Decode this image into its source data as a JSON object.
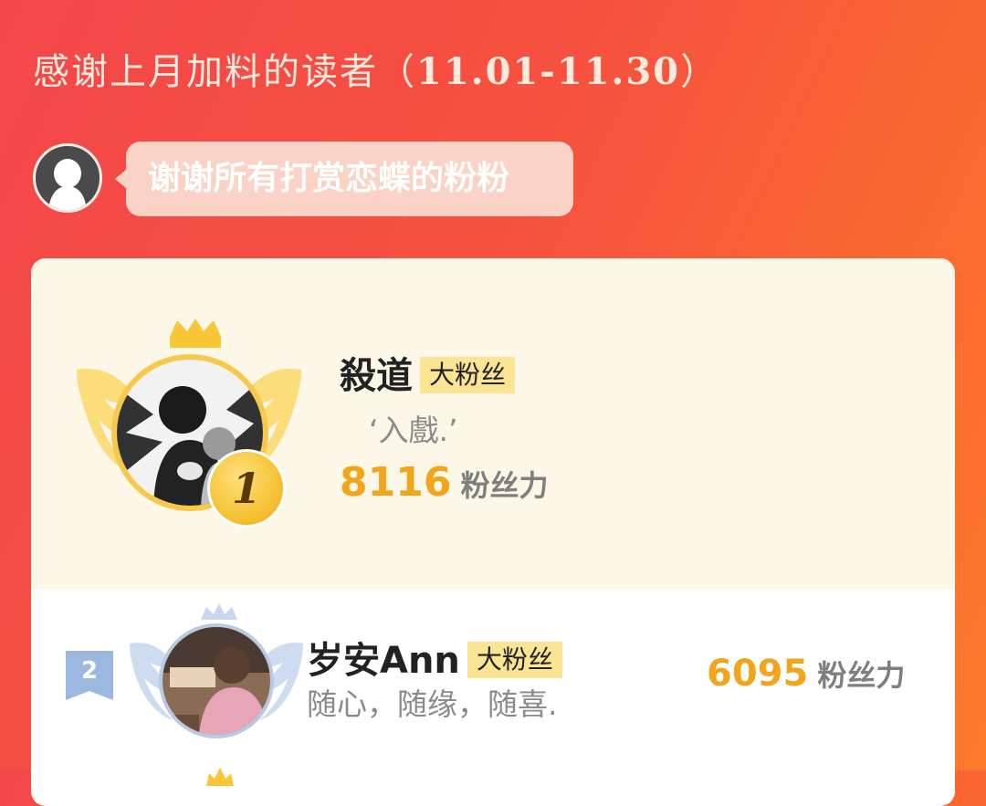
{
  "header": {
    "title_prefix": "感谢上月加料的读者（",
    "date_range": "11.01-11.30",
    "title_suffix": "）"
  },
  "message": {
    "avatar_icon": "ghost-avatar-icon",
    "text": "谢谢所有打赏恋蝶的粉粉"
  },
  "leaderboard": {
    "first": {
      "rank": "1",
      "name": "殺道",
      "badge": "大粉丝",
      "signature": "‘入戲.’",
      "score": "8116",
      "score_unit": "粉丝力",
      "icons": [
        "crown-icon",
        "gold-wings-icon",
        "gold-medal-icon"
      ]
    },
    "second": {
      "rank": "2",
      "name": "岁安Ann",
      "badge": "大粉丝",
      "signature": "随心，随缘，随喜.",
      "score": "6095",
      "score_unit": "粉丝力",
      "icons": [
        "silver-crown-icon",
        "silver-wings-icon",
        "rank-flag-icon"
      ]
    }
  },
  "colors": {
    "background_start": "#f4474a",
    "background_end": "#fd7a2c",
    "gold": "#f0a51a",
    "badge_bg": "#fbe594",
    "silver": "#b7c9e4"
  }
}
